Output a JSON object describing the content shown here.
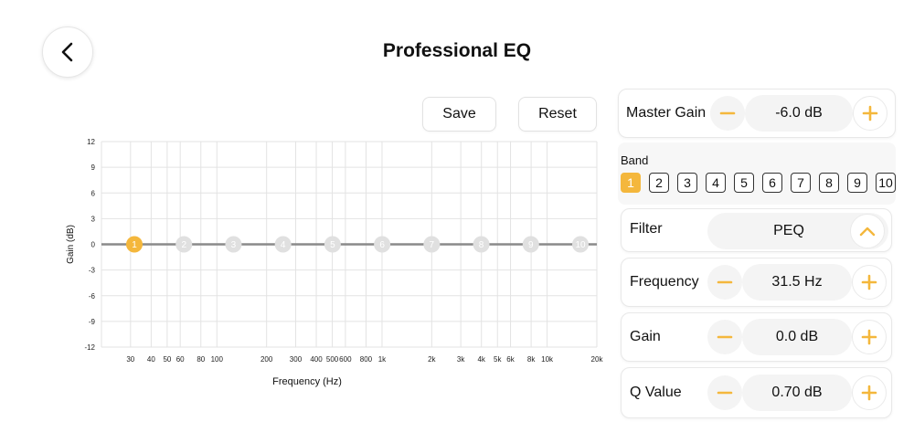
{
  "header": {
    "title": "Professional EQ"
  },
  "toolbar": {
    "save_label": "Save",
    "reset_label": "Reset"
  },
  "colors": {
    "accent": "#F4B73C",
    "grid": "#E3E3E3",
    "curve": "#8A8A8A",
    "inactive_point": "#E0E0E0"
  },
  "chart_data": {
    "type": "line",
    "xlabel": "Frequency (Hz)",
    "ylabel": "Gain (dB)",
    "x_scale": "log",
    "xlim": [
      20,
      20000
    ],
    "ylim": [
      -12,
      12
    ],
    "y_ticks": [
      "12",
      "9",
      "6",
      "3",
      "0",
      "-3",
      "-6",
      "-9",
      "-12"
    ],
    "x_ticks": [
      {
        "label": "30",
        "value": 30
      },
      {
        "label": "40",
        "value": 40
      },
      {
        "label": "50",
        "value": 50
      },
      {
        "label": "60",
        "value": 60
      },
      {
        "label": "80",
        "value": 80
      },
      {
        "label": "100",
        "value": 100
      },
      {
        "label": "200",
        "value": 200
      },
      {
        "label": "300",
        "value": 300
      },
      {
        "label": "400",
        "value": 400
      },
      {
        "label": "500",
        "value": 500
      },
      {
        "label": "600",
        "value": 600
      },
      {
        "label": "800",
        "value": 800
      },
      {
        "label": "1k",
        "value": 1000
      },
      {
        "label": "2k",
        "value": 2000
      },
      {
        "label": "3k",
        "value": 3000
      },
      {
        "label": "4k",
        "value": 4000
      },
      {
        "label": "5k",
        "value": 5000
      },
      {
        "label": "6k",
        "value": 6000
      },
      {
        "label": "8k",
        "value": 8000
      },
      {
        "label": "10k",
        "value": 10000
      },
      {
        "label": "20k",
        "value": 20000
      }
    ],
    "bands": [
      {
        "label": "1",
        "gain": 0,
        "active": true
      },
      {
        "label": "2",
        "gain": 0,
        "active": false
      },
      {
        "label": "3",
        "gain": 0,
        "active": false
      },
      {
        "label": "4",
        "gain": 0,
        "active": false
      },
      {
        "label": "5",
        "gain": 0,
        "active": false
      },
      {
        "label": "6",
        "gain": 0,
        "active": false
      },
      {
        "label": "7",
        "gain": 0,
        "active": false
      },
      {
        "label": "8",
        "gain": 0,
        "active": false
      },
      {
        "label": "9",
        "gain": 0,
        "active": false
      },
      {
        "label": "10",
        "gain": 0,
        "active": false
      }
    ]
  },
  "controls": {
    "master_gain": {
      "label": "Master Gain",
      "value": "-6.0 dB"
    },
    "band": {
      "label": "Band",
      "options": [
        "1",
        "2",
        "3",
        "4",
        "5",
        "6",
        "7",
        "8",
        "9",
        "10"
      ],
      "selected": "1"
    },
    "filter": {
      "label": "Filter",
      "value": "PEQ"
    },
    "frequency": {
      "label": "Frequency",
      "value": "31.5 Hz"
    },
    "gain": {
      "label": "Gain",
      "value": "0.0 dB"
    },
    "q_value": {
      "label": "Q Value",
      "value": "0.70 dB"
    }
  },
  "icons": {
    "back": "chevron-left-icon",
    "minus": "minus-icon",
    "plus": "plus-icon",
    "collapse": "chevron-up-icon"
  }
}
